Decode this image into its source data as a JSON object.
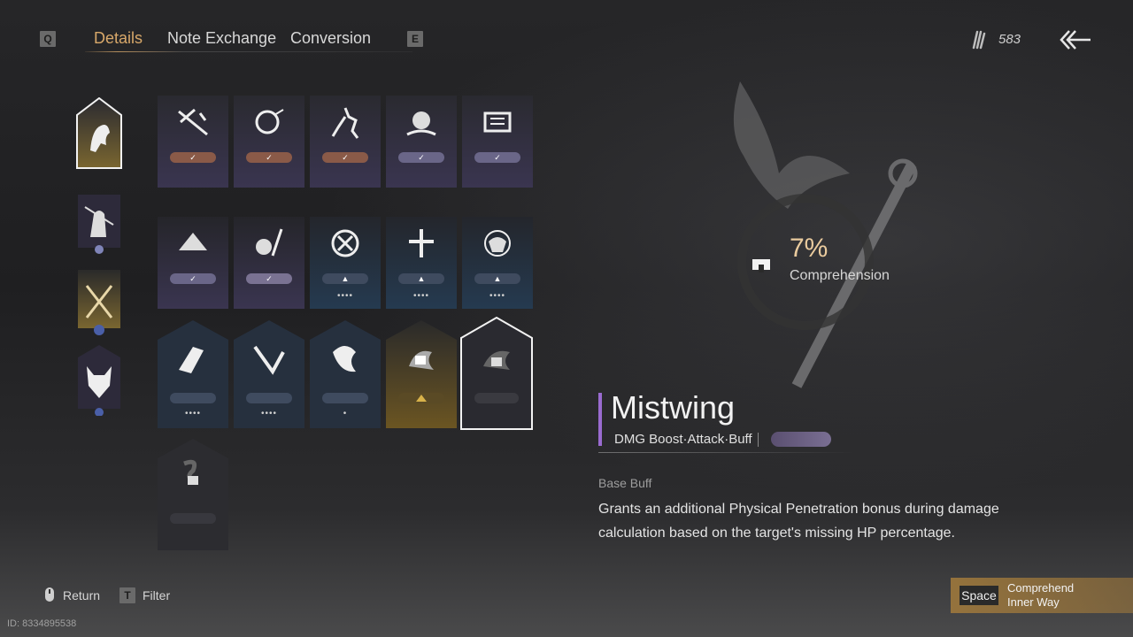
{
  "nav": {
    "left_key": "Q",
    "right_key": "E",
    "tabs": [
      {
        "label": "Details",
        "active": true
      },
      {
        "label": "Note Exchange",
        "active": false
      },
      {
        "label": "Conversion",
        "active": false
      }
    ]
  },
  "currency": {
    "icon": "feather-bundle-icon",
    "amount": "583"
  },
  "categories": [
    {
      "icon": "horse-icon",
      "selected": true
    },
    {
      "icon": "swordsman-icon",
      "selected": false
    },
    {
      "icon": "crossed-weapons-icon",
      "selected": false
    },
    {
      "icon": "wolf-icon",
      "selected": false
    }
  ],
  "cards": [
    {
      "icon": "spear-icon",
      "tier": "copper",
      "dots": ""
    },
    {
      "icon": "shell-icon",
      "tier": "copper",
      "dots": ""
    },
    {
      "icon": "rider-icon",
      "tier": "copper",
      "dots": ""
    },
    {
      "icon": "chains-icon",
      "tier": "violet",
      "dots": ""
    },
    {
      "icon": "scroll-icon",
      "tier": "violet",
      "dots": ""
    },
    {
      "icon": "hat-icon",
      "tier": "violet",
      "dots": ""
    },
    {
      "icon": "gourd-sword-icon",
      "tier": "violet-light",
      "dots": ""
    },
    {
      "icon": "sealed-circle-icon",
      "tier": "blue",
      "dots": "••••"
    },
    {
      "icon": "cross-icon",
      "tier": "blue",
      "dots": "••••"
    },
    {
      "icon": "muscle-icon",
      "tier": "blue",
      "dots": "••••"
    },
    {
      "icon": "slash-icon",
      "tier": "blue",
      "dots": "••••"
    },
    {
      "icon": "sweep-icon",
      "tier": "blue",
      "dots": "••••"
    },
    {
      "icon": "feather-swirl-icon",
      "tier": "blue",
      "dots": "•"
    },
    {
      "icon": "bird-locked-icon",
      "tier": "gold",
      "dots": ""
    },
    {
      "icon": "mistwing-icon",
      "tier": "dark",
      "dots": "",
      "selected": true
    },
    {
      "icon": "smoke-locked-icon",
      "tier": "dark",
      "dots": ""
    }
  ],
  "detail": {
    "comprehension_pct": "7%",
    "comprehension_label": "Comprehension",
    "title": "Mistwing",
    "tags": "DMG Boost·Attack·Buff",
    "section": "Base Buff",
    "description": "Grants an additional Physical Penetration bonus during damage calculation based on the target's missing HP percentage."
  },
  "footer": {
    "return_label": "Return",
    "filter_key": "T",
    "filter_label": "Filter",
    "id": "ID: 8334895538",
    "action_key": "Space",
    "action_line1": "Comprehend",
    "action_line2": "Inner Way"
  }
}
